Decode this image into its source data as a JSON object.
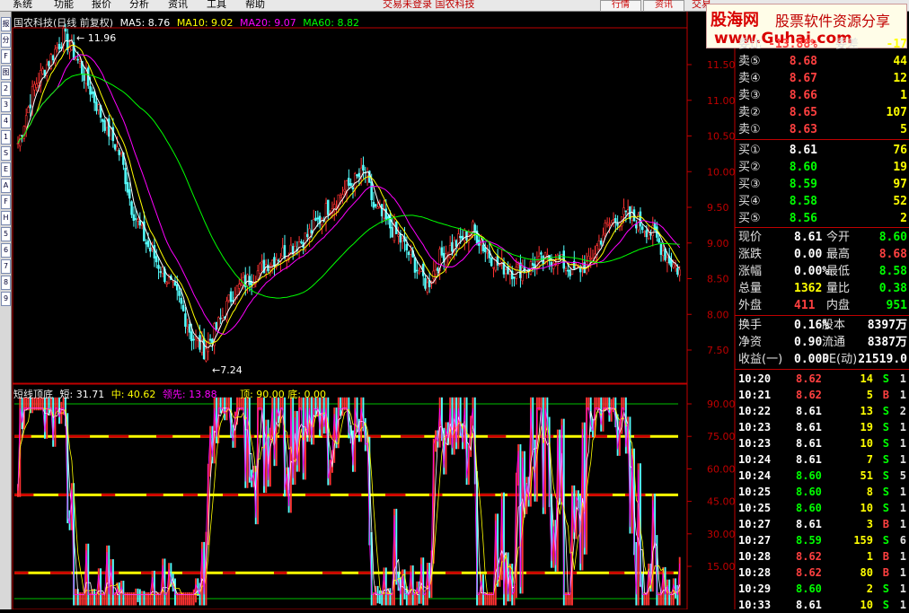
{
  "menu": {
    "items": [
      "系统",
      "功能",
      "报价",
      "分析",
      "资讯",
      "工具",
      "帮助"
    ],
    "center_text": "交易未登录 国农科技",
    "buttons": [
      "行情",
      "资讯"
    ],
    "right_text": "交易"
  },
  "logo": {
    "name": "股海网",
    "slogan": "股票软件资源分享",
    "url": "www.Guhai.com"
  },
  "leftbar": {
    "items": [
      "报",
      "分",
      "F",
      "图",
      "2",
      "3",
      "4",
      "1",
      "S",
      "E",
      "A",
      "F",
      "H",
      "5",
      "6",
      "7",
      "8",
      "9"
    ]
  },
  "chart": {
    "stock": "国农科技(日线 前复权)",
    "ma": [
      {
        "label": "MA5: 8.76",
        "color": "#ffffff"
      },
      {
        "label": "MA10: 9.02",
        "color": "#ffff00"
      },
      {
        "label": "MA20: 9.07",
        "color": "#ff00ff"
      },
      {
        "label": "MA60: 8.82",
        "color": "#00ff00"
      }
    ],
    "high_label": "11.96",
    "low_label": "7.24",
    "y_ticks": [
      "11.50",
      "11.00",
      "10.50",
      "10.00",
      "9.50",
      "9.00",
      "8.50",
      "8.00",
      "7.50"
    ]
  },
  "indicator": {
    "title": "短线顶底",
    "short": "短: 31.71",
    "mid": "中: 40.62",
    "lead": "领先: 13.88",
    "top_bottom": "顶: 90.00 底: 0.00",
    "y_ticks": [
      "90.00",
      "75.00",
      "60.00",
      "45.00",
      "30.00",
      "15.00"
    ]
  },
  "quote": {
    "header": {
      "label1": "委比",
      "value1": "-13.88%",
      "label2": "委差",
      "value2": "-17"
    },
    "sell": [
      {
        "label": "卖⑤",
        "price": "8.68",
        "vol": "44"
      },
      {
        "label": "卖④",
        "price": "8.67",
        "vol": "12"
      },
      {
        "label": "卖③",
        "price": "8.66",
        "vol": "1"
      },
      {
        "label": "卖②",
        "price": "8.65",
        "vol": "107"
      },
      {
        "label": "卖①",
        "price": "8.63",
        "vol": "5"
      }
    ],
    "buy": [
      {
        "label": "买①",
        "price": "8.61",
        "vol": "76"
      },
      {
        "label": "买②",
        "price": "8.60",
        "vol": "19"
      },
      {
        "label": "买③",
        "price": "8.59",
        "vol": "97"
      },
      {
        "label": "买④",
        "price": "8.58",
        "vol": "52"
      },
      {
        "label": "买⑤",
        "price": "8.56",
        "vol": "2"
      }
    ],
    "stats": [
      {
        "l1": "现价",
        "v1": "8.61",
        "c1": "#ffffff",
        "l2": "今开",
        "v2": "8.60",
        "c2": "#00ff00"
      },
      {
        "l1": "涨跌",
        "v1": "0.00",
        "c1": "#ffffff",
        "l2": "最高",
        "v2": "8.68",
        "c2": "#ff4040"
      },
      {
        "l1": "涨幅",
        "v1": "0.00%",
        "c1": "#ffffff",
        "l2": "最低",
        "v2": "8.58",
        "c2": "#00ff00"
      },
      {
        "l1": "总量",
        "v1": "1362",
        "c1": "#ffff00",
        "l2": "量比",
        "v2": "0.38",
        "c2": "#00ff00"
      },
      {
        "l1": "外盘",
        "v1": "411",
        "c1": "#ff4040",
        "l2": "内盘",
        "v2": "951",
        "c2": "#00ff00"
      }
    ],
    "stats2": [
      {
        "l1": "换手",
        "v1": "0.16%",
        "c1": "#ffffff",
        "l2": "股本",
        "v2": "8397万",
        "c2": "#ffffff"
      },
      {
        "l1": "净资",
        "v1": "0.90",
        "c1": "#ffffff",
        "l2": "流通",
        "v2": "8387万",
        "c2": "#ffffff"
      },
      {
        "l1": "收益(一)",
        "v1": "0.000",
        "c1": "#ffffff",
        "l2": "PE(动)",
        "v2": "21519.0",
        "c2": "#ffffff"
      }
    ],
    "ticks": [
      {
        "t": "10:20",
        "p": "8.62",
        "pc": "#ff4040",
        "v": "14",
        "d": "S",
        "dc": "#00ff00",
        "n": "1"
      },
      {
        "t": "10:21",
        "p": "8.62",
        "pc": "#ff4040",
        "v": "5",
        "d": "B",
        "dc": "#ff4040",
        "n": "1"
      },
      {
        "t": "10:22",
        "p": "8.61",
        "pc": "#ffffff",
        "v": "13",
        "d": "S",
        "dc": "#00ff00",
        "n": "2"
      },
      {
        "t": "10:23",
        "p": "8.61",
        "pc": "#ffffff",
        "v": "19",
        "d": "S",
        "dc": "#00ff00",
        "n": "1"
      },
      {
        "t": "10:23",
        "p": "8.61",
        "pc": "#ffffff",
        "v": "10",
        "d": "S",
        "dc": "#00ff00",
        "n": "1"
      },
      {
        "t": "10:24",
        "p": "8.61",
        "pc": "#ffffff",
        "v": "7",
        "d": "S",
        "dc": "#00ff00",
        "n": "1"
      },
      {
        "t": "10:24",
        "p": "8.60",
        "pc": "#00ff00",
        "v": "51",
        "d": "S",
        "dc": "#00ff00",
        "n": "5"
      },
      {
        "t": "10:25",
        "p": "8.60",
        "pc": "#00ff00",
        "v": "8",
        "d": "S",
        "dc": "#00ff00",
        "n": "1"
      },
      {
        "t": "10:25",
        "p": "8.60",
        "pc": "#00ff00",
        "v": "10",
        "d": "S",
        "dc": "#00ff00",
        "n": "1"
      },
      {
        "t": "10:27",
        "p": "8.61",
        "pc": "#ffffff",
        "v": "3",
        "d": "B",
        "dc": "#ff4040",
        "n": "1"
      },
      {
        "t": "10:27",
        "p": "8.59",
        "pc": "#00ff00",
        "v": "159",
        "d": "S",
        "dc": "#00ff00",
        "n": "6"
      },
      {
        "t": "10:28",
        "p": "8.62",
        "pc": "#ff4040",
        "v": "1",
        "d": "B",
        "dc": "#ff4040",
        "n": "1"
      },
      {
        "t": "10:28",
        "p": "8.62",
        "pc": "#ff4040",
        "v": "80",
        "d": "B",
        "dc": "#ff4040",
        "n": "1"
      },
      {
        "t": "10:29",
        "p": "8.60",
        "pc": "#00ff00",
        "v": "2",
        "d": "S",
        "dc": "#00ff00",
        "n": "1"
      },
      {
        "t": "10:33",
        "p": "8.61",
        "pc": "#ffffff",
        "v": "10",
        "d": "S",
        "dc": "#00ff00",
        "n": "1"
      }
    ]
  }
}
